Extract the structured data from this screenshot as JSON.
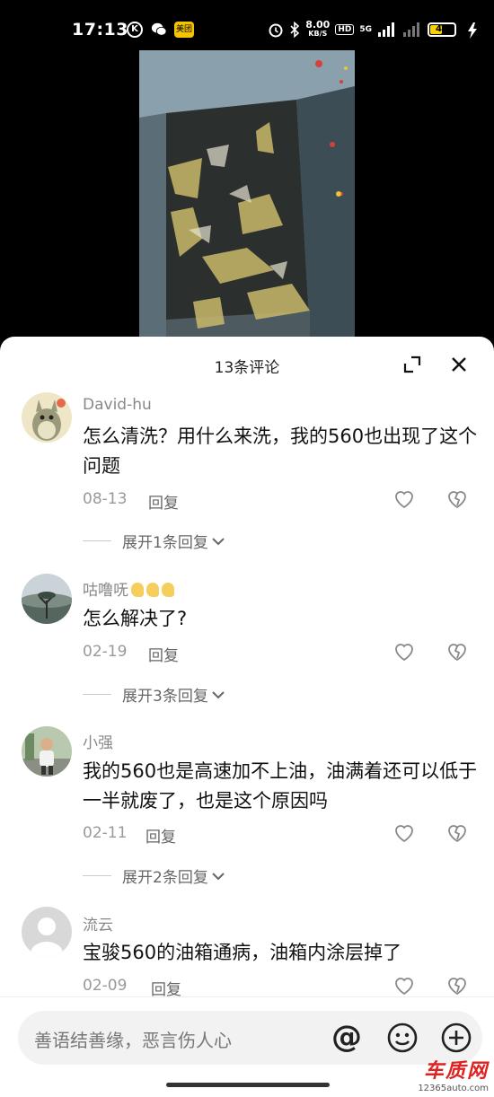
{
  "status_bar": {
    "time": "17:13",
    "k_label": "K",
    "meituan_label": "美团",
    "speed_value": "8.00",
    "speed_unit": "KB/S",
    "hd_label": "HD",
    "net_label": "5G",
    "battery": "47",
    "battery_level": 0.47
  },
  "panel": {
    "title": "13条评论"
  },
  "comments": [
    {
      "author": "David-hu",
      "text": "怎么清洗？用什么来洗，我的560也出现了这个问题",
      "date": "08-13",
      "reply_label": "回复",
      "expand_label": "展开1条回复"
    },
    {
      "author": "咕噜呒",
      "text": "怎么解决了?",
      "date": "02-19",
      "reply_label": "回复",
      "expand_label": "展开3条回复"
    },
    {
      "author": "小强",
      "text": "我的560也是高速加不上油，油满着还可以低于一半就废了，也是这个原因吗",
      "date": "02-11",
      "reply_label": "回复",
      "expand_label": "展开2条回复"
    },
    {
      "author": "流云",
      "text": "宝骏560的油箱通病，油箱内涂层掉了",
      "date": "02-09",
      "reply_label": "回复"
    }
  ],
  "input": {
    "placeholder": "善语结善缘，恶言伤人心",
    "at_label": "@"
  },
  "watermark": {
    "main": "车质网",
    "sub": "12365auto.com"
  },
  "colors": {
    "accent_yellow": "#f5c400",
    "text_primary": "#111111",
    "text_secondary": "#888888"
  }
}
